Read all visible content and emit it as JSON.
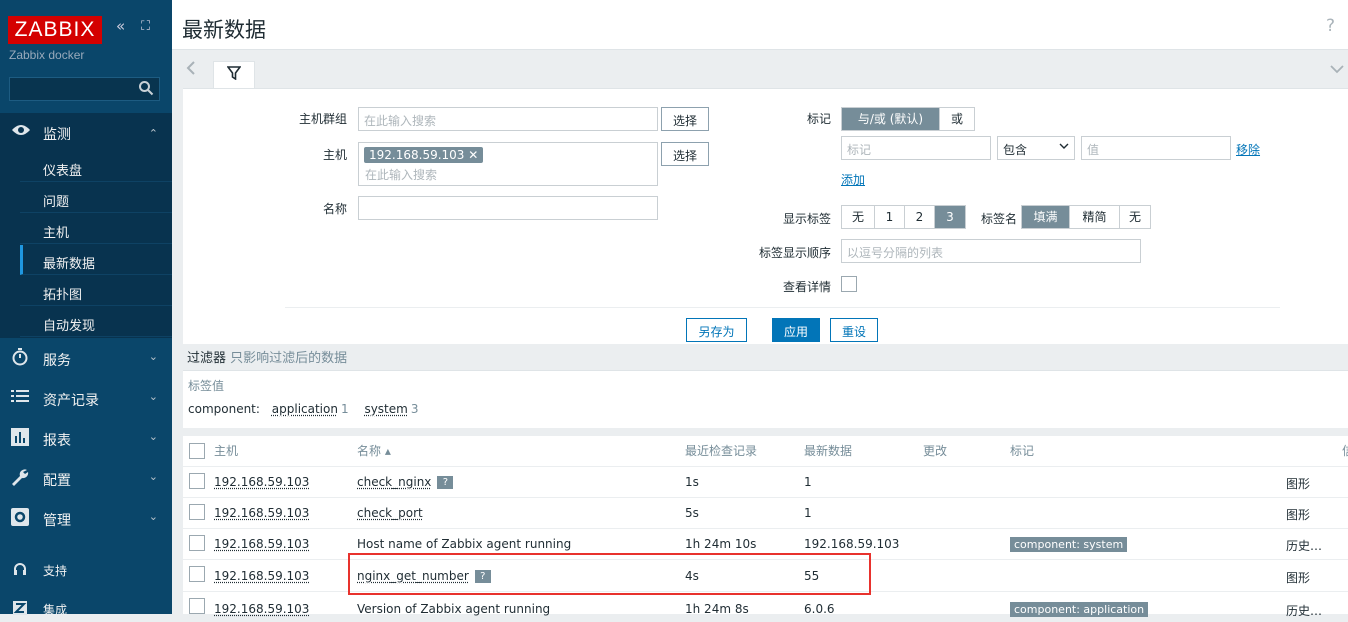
{
  "brand": {
    "logo": "ZABBIX",
    "server": "Zabbix docker",
    "collapse_icon": "«",
    "kiosk_icon": "⛶",
    "search_icon": "🔍"
  },
  "nav": {
    "monitoring": {
      "label": "监测",
      "icon": "eye-icon",
      "arrow": "⌃"
    },
    "sub": [
      "仪表盘",
      "问题",
      "主机",
      "最新数据",
      "拓扑图",
      "自动发现"
    ],
    "services": {
      "label": "服务",
      "icon": "timer-icon",
      "arrow": "⌄"
    },
    "inventory": {
      "label": "资产记录",
      "icon": "list-icon",
      "arrow": "⌄"
    },
    "reports": {
      "label": "报表",
      "icon": "chart-icon",
      "arrow": "⌄"
    },
    "config": {
      "label": "配置",
      "icon": "wrench-icon",
      "arrow": "⌄"
    },
    "admin": {
      "label": "管理",
      "icon": "gear-icon",
      "arrow": "⌄"
    },
    "support": {
      "label": "支持",
      "icon": "headset-icon"
    },
    "integrations": {
      "label": "集成",
      "icon": "z-icon"
    }
  },
  "header": {
    "title": "最新数据",
    "help": "?"
  },
  "filter": {
    "host_group_label": "主机群组",
    "host_group_placeholder": "在此输入搜索",
    "select": "选择",
    "host_label": "主机",
    "host_chip": "192.168.59.103",
    "chip_remove": "✕",
    "host_placeholder": "在此输入搜索",
    "name_label": "名称",
    "tags_label": "标记",
    "andor": "与/或 (默认)",
    "or": "或",
    "tag_placeholder": "标记",
    "operator": "包含",
    "value_placeholder": "值",
    "remove": "移除",
    "add": "添加",
    "show_tags_label": "显示标签",
    "show_tags_opts": [
      "无",
      "1",
      "2",
      "3"
    ],
    "tag_name_label": "标签名",
    "tag_name_opts": [
      "填满",
      "精简",
      "无"
    ],
    "tag_order_label": "标签显示顺序",
    "tag_order_placeholder": "以逗号分隔的列表",
    "details_label": "查看详情",
    "save_as": "另存为",
    "apply": "应用",
    "reset": "重设"
  },
  "filter_note": {
    "main": "过滤器",
    "sub": " 只影响过滤后的数据"
  },
  "tag_values": {
    "heading": "标签值",
    "key": "component:",
    "items": [
      {
        "name": "application",
        "count": "1"
      },
      {
        "name": "system",
        "count": "3"
      }
    ]
  },
  "table": {
    "headers": {
      "host": "主机",
      "name": "名称 ▴",
      "last_check": "最近检查记录",
      "last_value": "最新数据",
      "change": "更改",
      "tags": "标记",
      "info": "信"
    },
    "rows": [
      {
        "host": "192.168.59.103",
        "name": "check_nginx",
        "help": "?",
        "last_check": "1s",
        "last_value": "1",
        "tag": "",
        "action": "图形"
      },
      {
        "host": "192.168.59.103",
        "name": "check_port",
        "help": "",
        "last_check": "5s",
        "last_value": "1",
        "tag": "",
        "action": "图形"
      },
      {
        "host": "192.168.59.103",
        "name": "Host name of Zabbix agent running",
        "help": "",
        "last_check": "1h 24m 10s",
        "last_value": "192.168.59.103",
        "tag": "component: system",
        "action": "历史…"
      },
      {
        "host": "192.168.59.103",
        "name": "nginx_get_number",
        "help": "?",
        "last_check": "4s",
        "last_value": "55",
        "tag": "",
        "action": "图形"
      },
      {
        "host": "192.168.59.103",
        "name": "Version of Zabbix agent running",
        "help": "",
        "last_check": "1h 24m 8s",
        "last_value": "6.0.6",
        "tag": "component: application",
        "action": "历史…"
      }
    ]
  },
  "colors": {
    "sidebar": "#0a466a",
    "brand_red": "#d40000",
    "link": "#0275b8",
    "highlight": "#e8322d"
  }
}
